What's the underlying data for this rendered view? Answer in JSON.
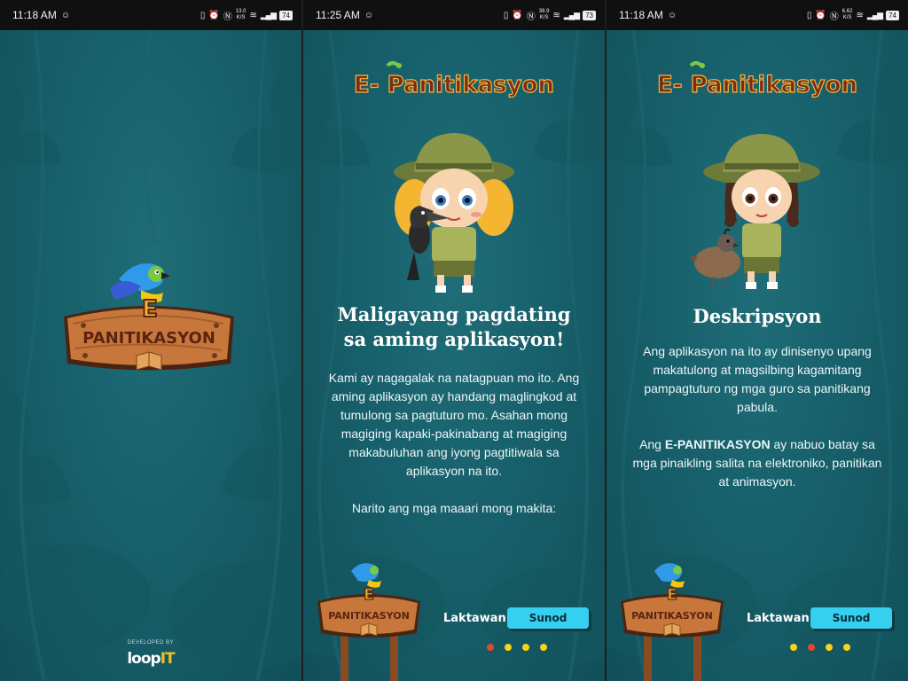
{
  "colors": {
    "background": "#17606b",
    "button": "#35d0ef",
    "dot_active": "#e8462c",
    "dot_inactive": "#f7d31a",
    "title_text": "#7a2d14"
  },
  "screens": [
    {
      "status": {
        "time": "11:18 AM",
        "speed_top": "13.0",
        "speed_unit": "K/S",
        "battery": "74"
      },
      "splash": {
        "logo_letter": "E",
        "logo_word": "PANITIKASYON",
        "developed_by": "DEVELOPED BY",
        "brand_a": "loop",
        "brand_b": "IT"
      }
    },
    {
      "status": {
        "time": "11:25 AM",
        "speed_top": "38.9",
        "speed_unit": "K/S",
        "battery": "73"
      },
      "title": "E- Panitikasyon",
      "heading_line1": "Maligayang pagdating",
      "heading_line2": "sa aming aplikasyon!",
      "paragraph1": "Kami ay nagagalak na natagpuan mo ito. Ang aming aplikasyon ay handang maglingkod at tumulong sa pagtuturo mo. Asahan mong magiging kapaki-pakinabang at magiging makabuluhan ang iyong pagtitiwala sa aplikasyon na ito.",
      "paragraph2": "Narito ang mga maaari mong makita:",
      "sign_letter": "E",
      "sign_word": "PANITIKASYON",
      "skip_label": "Laktawan",
      "next_label": "Sunod",
      "active_dot": 1
    },
    {
      "status": {
        "time": "11:18 AM",
        "speed_top": "6.62",
        "speed_unit": "K/S",
        "battery": "74"
      },
      "title": "E- Panitikasyon",
      "heading": "Deskripsyon",
      "paragraph1": "Ang aplikasyon na ito ay dinisenyo upang makatulong at magsilbing kagamitang pampagtuturo ng mga guro sa panitikang pabula.",
      "paragraph2_pre": "Ang ",
      "paragraph2_bold": "E-PANITIKASYON",
      "paragraph2_post": " ay nabuo batay sa mga pinaikling salita na elektroniko, panitikan at animasyon.",
      "sign_letter": "E",
      "sign_word": "PANITIKASYON",
      "skip_label": "Laktawan",
      "next_label": "Sunod",
      "active_dot": 2
    }
  ]
}
